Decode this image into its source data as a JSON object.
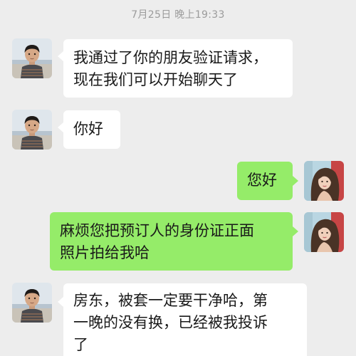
{
  "chat": {
    "timestamp": "7月25日 晚上19:33",
    "messages": [
      {
        "sender": "contact",
        "lines": [
          "我通过了你的朋友验证请求，",
          "现在我们可以开始聊天了"
        ]
      },
      {
        "sender": "contact",
        "lines": [
          "你好"
        ]
      },
      {
        "sender": "me",
        "lines": [
          "您好"
        ]
      },
      {
        "sender": "me",
        "lines": [
          "麻烦您把预订人的身份证正面",
          "照片拍给我哈"
        ]
      },
      {
        "sender": "contact",
        "lines": [
          "房东，被套一定要干净哈，第",
          "一晚的没有换，已经被我投诉",
          "了"
        ]
      }
    ]
  },
  "colors": {
    "background": "#ededed",
    "incoming_bubble": "#ffffff",
    "outgoing_bubble": "#95ec69",
    "timestamp_text": "#9b9b9b"
  },
  "icons": {
    "contact_avatar": "boy-photo-avatar",
    "me_avatar": "woman-photo-avatar"
  }
}
